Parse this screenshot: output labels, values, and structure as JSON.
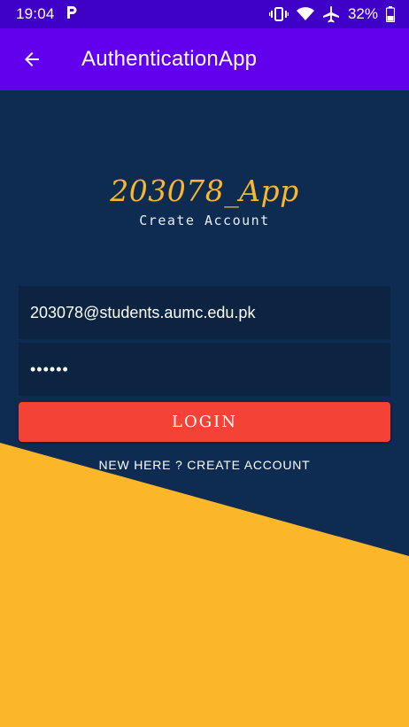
{
  "status_bar": {
    "time": "19:04",
    "notification_icon": "p-app-icon",
    "battery_percent": "32%",
    "icons": [
      "vibrate-icon",
      "wifi-icon",
      "airplane-icon",
      "battery-icon"
    ]
  },
  "app_bar": {
    "title": "AuthenticationApp",
    "back_icon": "arrow-back-icon"
  },
  "logo": {
    "title": "203078_App",
    "subtitle": "Create Account"
  },
  "form": {
    "email_value": "203078@students.aumc.edu.pk",
    "password_value": "••••••",
    "login_label": "LOGIN",
    "signup_link": "NEW HERE ? CREATE ACCOUNT"
  },
  "colors": {
    "status_bar": "#3f00c7",
    "app_bar": "#6200ee",
    "background": "#0e2b52",
    "field_background": "#0c2441",
    "accent_yellow": "#fbb62a",
    "button_red": "#f44336"
  }
}
